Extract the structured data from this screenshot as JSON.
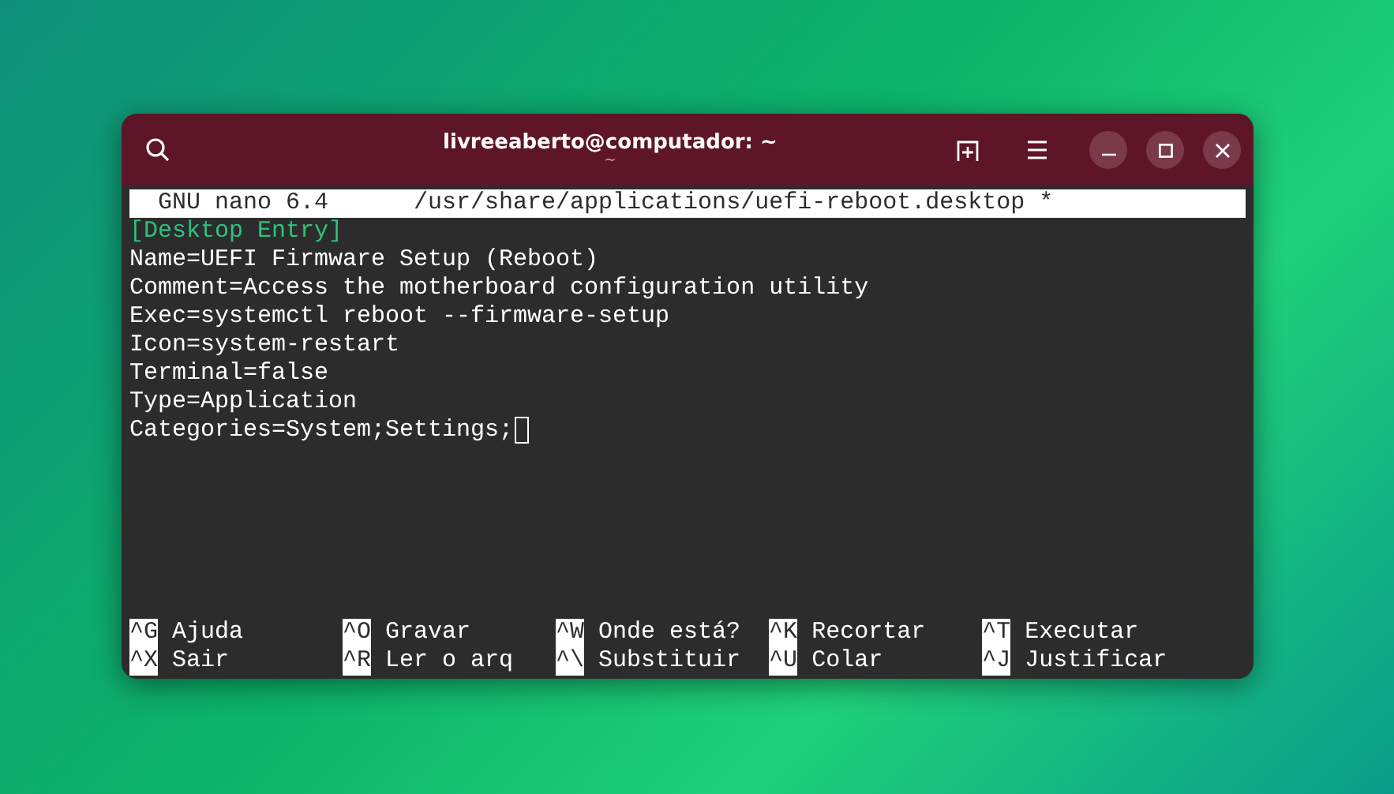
{
  "window": {
    "title": "livreeaberto@computador: ~",
    "subtitle": "~"
  },
  "nano": {
    "version": "GNU nano 6.4",
    "filename": "/usr/share/applications/uefi-reboot.desktop *",
    "lines": [
      {
        "kind": "section",
        "text": "[Desktop Entry]",
        "cursor": false
      },
      {
        "kind": "text",
        "text": "Name=UEFI Firmware Setup (Reboot)",
        "cursor": false
      },
      {
        "kind": "text",
        "text": "Comment=Access the motherboard configuration utility",
        "cursor": false
      },
      {
        "kind": "text",
        "text": "Exec=systemctl reboot --firmware-setup",
        "cursor": false
      },
      {
        "kind": "text",
        "text": "Icon=system-restart",
        "cursor": false
      },
      {
        "kind": "text",
        "text": "Terminal=false",
        "cursor": false
      },
      {
        "kind": "text",
        "text": "Type=Application",
        "cursor": false
      },
      {
        "kind": "text",
        "text": "Categories=System;Settings;",
        "cursor": true
      }
    ],
    "shortcuts": [
      [
        {
          "key": "^G",
          "label": "Ajuda"
        },
        {
          "key": "^O",
          "label": "Gravar"
        },
        {
          "key": "^W",
          "label": "Onde está?"
        },
        {
          "key": "^K",
          "label": "Recortar"
        },
        {
          "key": "^T",
          "label": "Executar"
        }
      ],
      [
        {
          "key": "^X",
          "label": "Sair"
        },
        {
          "key": "^R",
          "label": "Ler o arq"
        },
        {
          "key": "^\\",
          "label": "Substituir"
        },
        {
          "key": "^U",
          "label": "Colar"
        },
        {
          "key": "^J",
          "label": "Justificar"
        }
      ]
    ]
  }
}
